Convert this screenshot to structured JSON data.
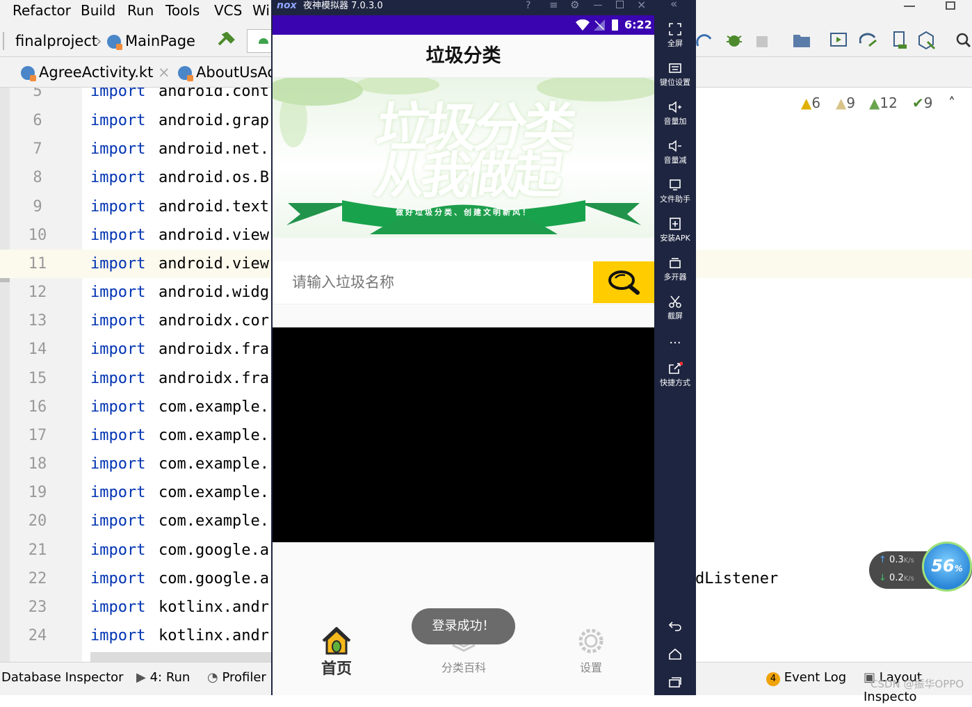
{
  "ide": {
    "menu": [
      "Refactor",
      "Build",
      "Run",
      "Tools",
      "VCS",
      "Wi"
    ],
    "breadcrumb": {
      "project": "finalproject",
      "file": "MainPage"
    },
    "tabs": [
      "AgreeActivity.kt",
      "AboutUsAc"
    ],
    "inspections": {
      "warn1": "6",
      "warn2": "9",
      "warn3": "12",
      "ok": "9"
    },
    "lines": [
      {
        "n": "5",
        "kw": "import",
        "text": "android.cont"
      },
      {
        "n": "6",
        "kw": "import",
        "text": "android.grap"
      },
      {
        "n": "7",
        "kw": "import",
        "text": "android.net."
      },
      {
        "n": "8",
        "kw": "import",
        "text": "android.os.B"
      },
      {
        "n": "9",
        "kw": "import",
        "text": "android.text"
      },
      {
        "n": "10",
        "kw": "import",
        "text": "android.view"
      },
      {
        "n": "11",
        "kw": "import",
        "text": "android.view"
      },
      {
        "n": "12",
        "kw": "import",
        "text": "android.widg"
      },
      {
        "n": "13",
        "kw": "import",
        "text": "androidx.cor"
      },
      {
        "n": "14",
        "kw": "import",
        "text": "androidx.fra"
      },
      {
        "n": "15",
        "kw": "import",
        "text": "androidx.fra"
      },
      {
        "n": "16",
        "kw": "import",
        "text": "com.example."
      },
      {
        "n": "17",
        "kw": "import",
        "text": "com.example."
      },
      {
        "n": "18",
        "kw": "import",
        "text": "com.example."
      },
      {
        "n": "19",
        "kw": "import",
        "text": "com.example."
      },
      {
        "n": "20",
        "kw": "import",
        "text": "com.example."
      },
      {
        "n": "21",
        "kw": "import",
        "text": "com.google.a"
      },
      {
        "n": "22",
        "kw": "import",
        "text": "com.google.a"
      },
      {
        "n": "23",
        "kw": "import",
        "text": "kotlinx.andr"
      },
      {
        "n": "24",
        "kw": "import",
        "text": "kotlinx.andr"
      }
    ],
    "right_code": "dListener",
    "status": {
      "database": "Database Inspector",
      "run": "4: Run",
      "profiler": "Profiler",
      "event_count": "4",
      "event_log": "Event Log",
      "layout_inspector": "Layout Inspecto"
    },
    "watermark": "CSDN @振华OPPO"
  },
  "emulator": {
    "title": "夜神模拟器 7.0.3.0",
    "sidebar": [
      "全屏",
      "键位设置",
      "音量加",
      "音量减",
      "文件助手",
      "安装APK",
      "多开器",
      "截屏",
      "...",
      "快捷方式"
    ],
    "net": {
      "up": "0.3",
      "down": "0.2",
      "unit": "K/s",
      "percent": "56"
    }
  },
  "app": {
    "time": "6:22",
    "title": "垃圾分类",
    "banner": {
      "line1": "垃圾分类",
      "line2": "从我做起",
      "ribbon": "做好垃圾分类、创建文明新风！"
    },
    "search": {
      "placeholder": "请输入垃圾名称"
    },
    "toast": "登录成功！",
    "tabs": [
      {
        "label": "首页",
        "active": true
      },
      {
        "label": "分类百科",
        "active": false
      },
      {
        "label": "设置",
        "active": false
      }
    ]
  },
  "colors": {
    "status_bar": "#3a05b0",
    "search_button": "#ffcc00",
    "emulator_chrome": "#1e2540",
    "keyword": "#0033b3"
  }
}
